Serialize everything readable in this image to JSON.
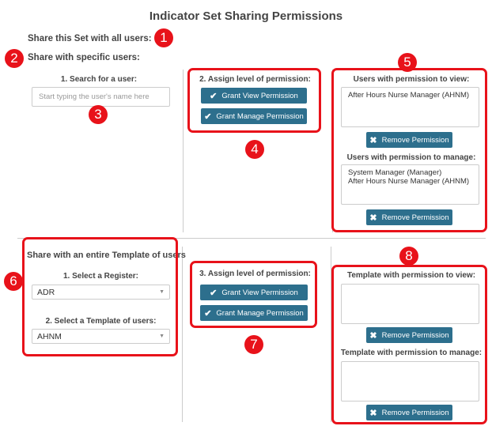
{
  "title": "Indicator Set Sharing Permissions",
  "share_all_label": "Share this Set with all users:",
  "share_specific_label": "Share with specific users:",
  "users": {
    "search_heading": "1. Search for a user:",
    "search_placeholder": "Start typing the user's name here",
    "assign_heading": "2. Assign level of permission:",
    "grant_view": "Grant View Permission",
    "grant_manage": "Grant Manage Permission",
    "view_heading": "Users with permission to view:",
    "view_list": [
      "After Hours Nurse Manager (AHNM)"
    ],
    "remove_permission": "Remove Permission",
    "manage_heading": "Users with permission to manage:",
    "manage_list": [
      "System Manager (Manager)",
      "After Hours Nurse Manager (AHNM)"
    ]
  },
  "template": {
    "section_heading": "Share with an entire Template of users",
    "register_heading": "1. Select a Register:",
    "register_value": "ADR",
    "template_heading": "2. Select a Template of users:",
    "template_value": "AHNM",
    "assign_heading": "3. Assign level of permission:",
    "grant_view": "Grant View Permission",
    "grant_manage": "Grant Manage Permission",
    "view_heading": "Template with permission to view:",
    "remove_permission": "Remove Permission",
    "manage_heading": "Template with permission to manage:"
  },
  "badges": [
    "1",
    "2",
    "3",
    "4",
    "5",
    "6",
    "7",
    "8"
  ],
  "colors": {
    "button": "#2d6f8d",
    "annotation": "#e8121a"
  },
  "icons": {
    "grant": "check-icon",
    "remove": "times-icon",
    "select": "caret-down-icon"
  }
}
